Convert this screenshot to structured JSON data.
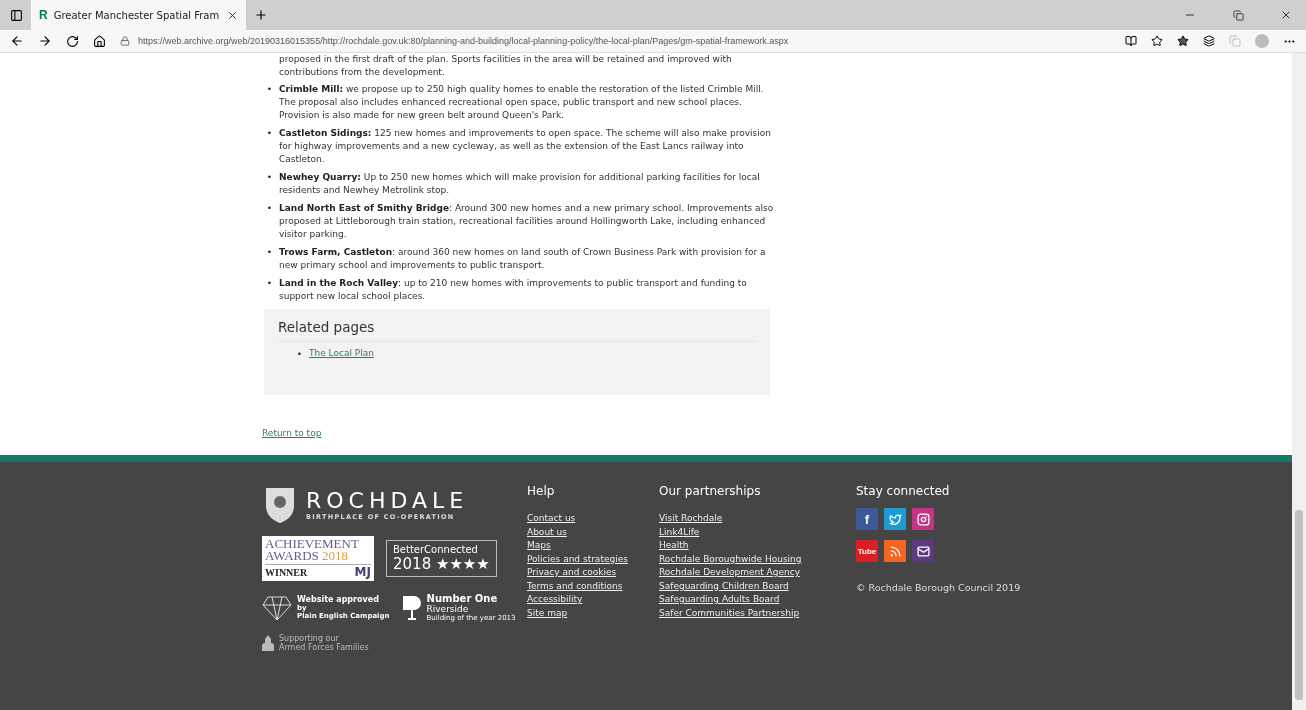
{
  "browser": {
    "tab": {
      "favicon": "R",
      "title": "Greater Manchester Spatial Fram"
    },
    "url": "https://web.archive.org/web/20190316015355/http://rochdale.gov.uk:80/planning-and-building/local-planning-policy/the-local-plan/Pages/gm-spatial-framework.aspx"
  },
  "article": {
    "lead": "proposed in the first draft of the plan. Sports facilities in the area will be retained and improved with contributions from the development.",
    "items": [
      {
        "bullet": "•",
        "text": "**Crimble Mill:** we propose up to 250 high quality homes to enable the restoration of the listed Crimble Mill. The proposal also includes enhanced recreational open space, public transport and new school places. Provision is also made for new green belt around Queen's Park."
      },
      {
        "bullet": "•",
        "text": "**Castleton Sidings:** 125 new homes and improvements to open space. The scheme will also make provision for highway improvements and a new cycleway, as well as the extension of the East Lancs railway into Castleton."
      },
      {
        "bullet": "•",
        "text": "**Newhey Quarry:** Up to 250 new homes which will make provision for additional parking facilities for local residents and Newhey Metrolink stop."
      },
      {
        "bullet": "•",
        "text": "**Land North East of Smithy Bridge**: Around 300 new homes and a new primary school. Improvements also proposed at Littleborough train station, recreational facilities around Hollingworth Lake, including enhanced visitor parking."
      },
      {
        "bullet": "•",
        "text": "**Trows Farm, Castleton**: around 360 new homes on land south of Crown Business Park with provision for a new primary school and improvements to public transport."
      },
      {
        "bullet": "•",
        "text": "**Land in the Roch Valley**: up to 210 new homes with improvements to public transport and funding to support new local school places."
      }
    ]
  },
  "related": {
    "title": "Related pages",
    "links": [
      {
        "bullet": "•",
        "label": "The Local Plan"
      }
    ]
  },
  "return_link": "Return to top",
  "footer": {
    "brand": {
      "name": "ROCHDALE",
      "tagline": "BIRTHPLACE OF CO-OPERATION"
    },
    "awards": {
      "achievement": [
        "ACHIEVEMENT",
        "AWARDS",
        "2018",
        "WINNER",
        "MJ"
      ],
      "better_connected": [
        "BetterConnected",
        "2018 ★★★★"
      ],
      "plain_english": [
        "Website approved",
        "by",
        "Plain English Campaign"
      ],
      "number_one": [
        "Number One",
        "Riverside",
        "Building of the year 2013"
      ],
      "armed_forces": [
        "Supporting our",
        "Armed Forces Families"
      ]
    },
    "help": {
      "title": "Help",
      "links": [
        "Contact us",
        "About us",
        "Maps",
        "Policies and strategies",
        "Privacy and cookies",
        "Terms and conditions",
        "Accessibility",
        "Site map"
      ]
    },
    "partnerships": {
      "title": "Our partnerships",
      "links": [
        "Visit Rochdale",
        "Link4Life",
        "Health",
        "Rochdale Boroughwide Housing",
        "Rochdale Development Agency",
        "Safeguarding Children Board",
        "Safeguarding Adults Board",
        "Safer Communities Partnership"
      ]
    },
    "social": {
      "title": "Stay connected",
      "rows": [
        [
          {
            "kind": "facebook",
            "color": "#3b5998",
            "glyph": "f"
          },
          {
            "kind": "twitter",
            "color": "#1d9bd1"
          },
          {
            "kind": "instagram",
            "color": "#c13584"
          }
        ],
        [
          {
            "kind": "youtube",
            "color": "#d81f26",
            "glyph": "Tube"
          },
          {
            "kind": "rss",
            "color": "#f26522"
          },
          {
            "kind": "email",
            "color": "#5b3a7e"
          }
        ]
      ]
    },
    "copyright": "© Rochdale Borough Council 2019"
  }
}
